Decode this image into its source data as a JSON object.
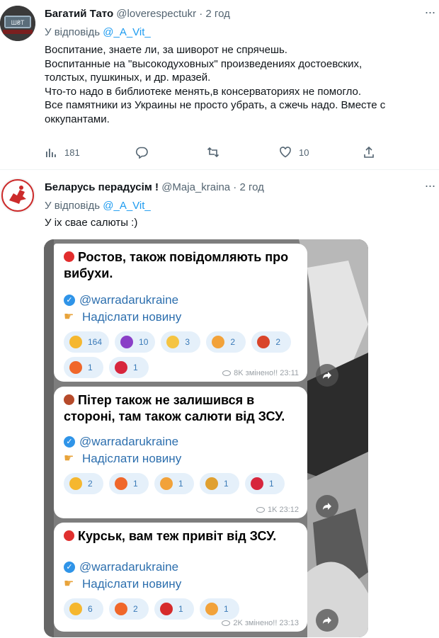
{
  "tweets": [
    {
      "author": "Багатий Тато",
      "handle": "@loverespectukr",
      "separator": "·",
      "time": "2 год",
      "reply_prefix": "У відповідь",
      "reply_to": "@_A_Vit_",
      "text_lines": [
        "Воспитание, знаете ли, за шиворот не спрячешь.",
        "Воспитанные на \"высокодуховных\" произведениях достоевских,",
        "толстых, пушкиных, и др. мразей.",
        "Что-то надо в библиотеке менять,в консерваториях не помогло.",
        "Все памятники из Украины не просто убрать, а сжечь надо. Вместе с",
        "оккупантами."
      ],
      "stats": {
        "views": "181",
        "likes": "10"
      }
    },
    {
      "author": "Беларусь перадусім !",
      "handle": "@Maja_kraina",
      "separator": "·",
      "time": "2 год",
      "reply_prefix": "У відповідь",
      "reply_to": "@_A_Vit_",
      "text_lines": [
        "У іх свае салюты :)"
      ]
    }
  ],
  "telegram": {
    "posts": [
      {
        "title_lines": [
          "Ростов, також повідомляють про",
          "вибухи."
        ],
        "channel": "@warradarukraine",
        "cta": "Надіслати новину",
        "reactions": [
          {
            "icon": "thumbs-up",
            "count": "164"
          },
          {
            "icon": "devil",
            "count": "10"
          },
          {
            "icon": "ok-hand",
            "count": "3"
          },
          {
            "icon": "smiling-hearts",
            "count": "2"
          },
          {
            "icon": "cursing-face",
            "count": "2"
          },
          {
            "icon": "fire",
            "count": "1"
          },
          {
            "icon": "broken-heart",
            "count": "1"
          }
        ],
        "meta": "8K змінено!! 23:11"
      },
      {
        "title_lines": [
          "Пітер також не залишився в",
          "стороні, там також салюти від ЗСУ."
        ],
        "channel": "@warradarukraine",
        "cta": "Надіслати новину",
        "reactions": [
          {
            "icon": "thumbs-up",
            "count": "2"
          },
          {
            "icon": "fire",
            "count": "1"
          },
          {
            "icon": "smiling-hearts",
            "count": "1"
          },
          {
            "icon": "party-popper",
            "count": "1"
          },
          {
            "icon": "broken-heart",
            "count": "1"
          }
        ],
        "meta": "1K 23:12"
      },
      {
        "title_lines": [
          "Курськ, вам теж привіт від ЗСУ."
        ],
        "channel": "@warradarukraine",
        "cta": "Надіслати новину",
        "reactions": [
          {
            "icon": "thumbs-up",
            "count": "6"
          },
          {
            "icon": "fire",
            "count": "2"
          },
          {
            "icon": "heart-on-fire",
            "count": "1"
          },
          {
            "icon": "smiling-hearts",
            "count": "1"
          }
        ],
        "meta": "2K змінено!! 23:13"
      }
    ]
  },
  "colors": {
    "link": "#1d9bf0",
    "muted": "#536471",
    "tg_link": "#2d6fae",
    "tg_reaction_bg": "#e5f0fa"
  }
}
